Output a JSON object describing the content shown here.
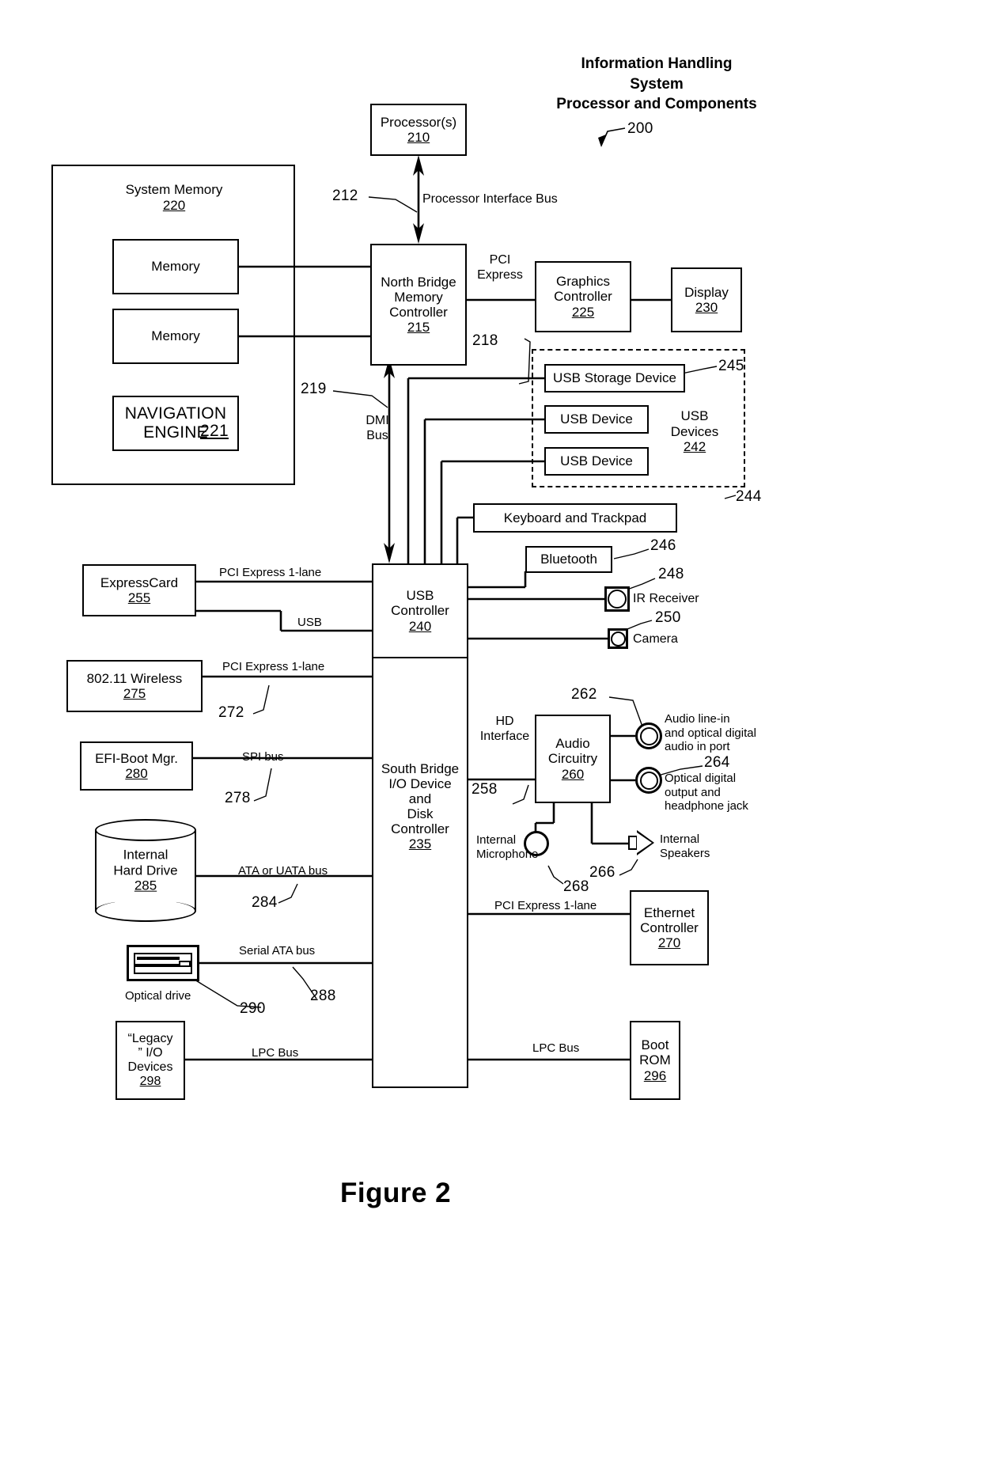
{
  "figure": {
    "caption": "Figure 2",
    "title_lines": [
      "Information Handling",
      "System",
      "Processor and Components"
    ],
    "title_ref": "200"
  },
  "blocks": {
    "processor": {
      "label": "Processor(s)",
      "num": "210"
    },
    "north_bridge": {
      "label": "North Bridge\nMemory\nController",
      "num": "215"
    },
    "graphics": {
      "label": "Graphics\nController",
      "num": "225"
    },
    "display": {
      "label": "Display",
      "num": "230"
    },
    "system_memory": {
      "label": "System Memory",
      "num": "220"
    },
    "memory_1": {
      "label": "Memory"
    },
    "memory_2": {
      "label": "Memory"
    },
    "navigation_engine": {
      "label": "NAVIGATION\nENGINE",
      "num": "221"
    },
    "usb_storage": {
      "label": "USB Storage Device"
    },
    "usb_device_1": {
      "label": "USB Device"
    },
    "usb_device_2": {
      "label": "USB Device"
    },
    "usb_devices_group": {
      "label": "USB\nDevices",
      "num": "242"
    },
    "keyboard": {
      "label": "Keyboard and Trackpad"
    },
    "bluetooth": {
      "label": "Bluetooth"
    },
    "ir_receiver": {
      "label": "IR Receiver"
    },
    "camera": {
      "label": "Camera"
    },
    "usb_controller": {
      "label": "USB\nController",
      "num": "240"
    },
    "south_bridge": {
      "label": "South Bridge\nI/O Device\nand\nDisk\nController",
      "num": "235"
    },
    "expresscard": {
      "label": "ExpressCard",
      "num": "255"
    },
    "wireless": {
      "label": "802.11 Wireless",
      "num": "275"
    },
    "efi_boot": {
      "label": "EFI-Boot Mgr.",
      "num": "280"
    },
    "hard_drive": {
      "label": "Internal\nHard Drive",
      "num": "285"
    },
    "optical_drive": {
      "label": "Optical drive"
    },
    "legacy_io": {
      "label": "“Legacy\n” I/O\nDevices",
      "num": "298"
    },
    "audio_circuitry": {
      "label": "Audio\nCircuitry",
      "num": "260"
    },
    "internal_mic": {
      "label": "Internal\nMicrophone"
    },
    "internal_speakers": {
      "label": "Internal\nSpeakers"
    },
    "audio_in_port": {
      "label": "Audio line-in\nand optical digital\naudio in port"
    },
    "audio_out_port": {
      "label": "Optical digital\noutput and\nheadphone jack"
    },
    "ethernet": {
      "label": "Ethernet\nController",
      "num": "270"
    },
    "boot_rom": {
      "label": "Boot\nROM",
      "num": "296"
    }
  },
  "bus_labels": {
    "processor_interface": "Processor Interface Bus",
    "pci_express": "PCI\nExpress",
    "dmi_bus": "DMI\nBus",
    "hd_interface": "HD\nInterface",
    "pci_express_1lane_expresscard": "PCI Express 1-lane",
    "usb": "USB",
    "pci_express_1lane_wireless": "PCI Express 1-lane",
    "spi_bus": "SPI bus",
    "ata_bus": "ATA or UATA bus",
    "serial_ata_bus": "Serial ATA bus",
    "lpc_bus_left": "LPC Bus",
    "lpc_bus_right": "LPC Bus",
    "pci_express_1lane_ethernet": "PCI Express 1-lane"
  },
  "ref_numbers": {
    "n212": "212",
    "n218": "218",
    "n219": "219",
    "n244": "244",
    "n245": "245",
    "n246": "246",
    "n248": "248",
    "n250": "250",
    "n258": "258",
    "n262": "262",
    "n264": "264",
    "n266": "266",
    "n268": "268",
    "n272": "272",
    "n278": "278",
    "n284": "284",
    "n288": "288",
    "n290": "290"
  }
}
